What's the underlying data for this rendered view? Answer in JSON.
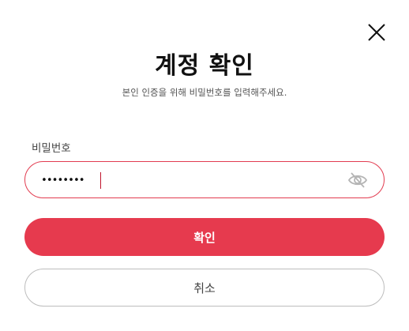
{
  "dialog": {
    "title": "계정 확인",
    "subtitle": "본인 인증을 위해 비밀번호를 입력해주세요.",
    "close_icon": "close-icon"
  },
  "password_field": {
    "label": "비밀번호",
    "value": "••••••••",
    "toggle_icon": "eye-slash-icon"
  },
  "actions": {
    "confirm_label": "확인",
    "cancel_label": "취소"
  },
  "colors": {
    "accent": "#e63a4e",
    "field_border": "#e23c50",
    "cancel_border": "#bdbdbd"
  }
}
